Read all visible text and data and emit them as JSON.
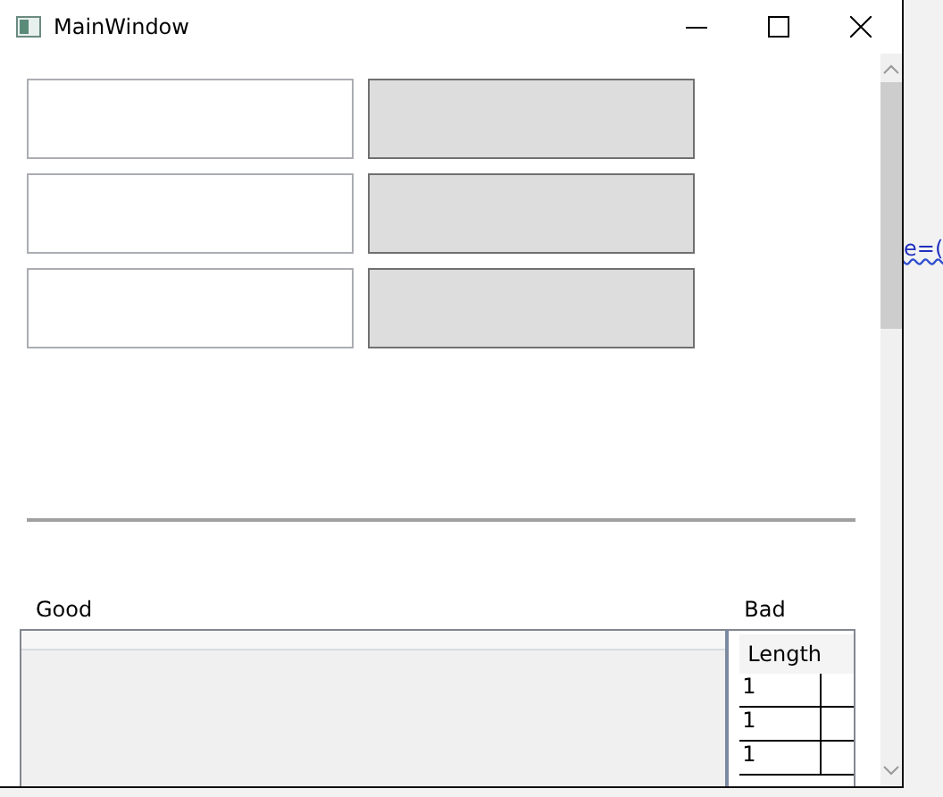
{
  "window": {
    "title": "MainWindow",
    "controls": [
      {
        "kind": "minimize"
      },
      {
        "kind": "maximize"
      },
      {
        "kind": "close"
      }
    ]
  },
  "text_boxes": [
    {
      "kind": "input"
    },
    {
      "kind": "input"
    },
    {
      "kind": "input"
    }
  ],
  "gray_boxes": [
    {
      "kind": "box"
    },
    {
      "kind": "box"
    },
    {
      "kind": "box"
    }
  ],
  "good": {
    "label": "Good"
  },
  "bad": {
    "label": "Bad",
    "columns": [
      "Length"
    ],
    "rows": [
      [
        "1"
      ],
      [
        "1"
      ],
      [
        "1"
      ]
    ]
  },
  "background_text": "e=("
}
